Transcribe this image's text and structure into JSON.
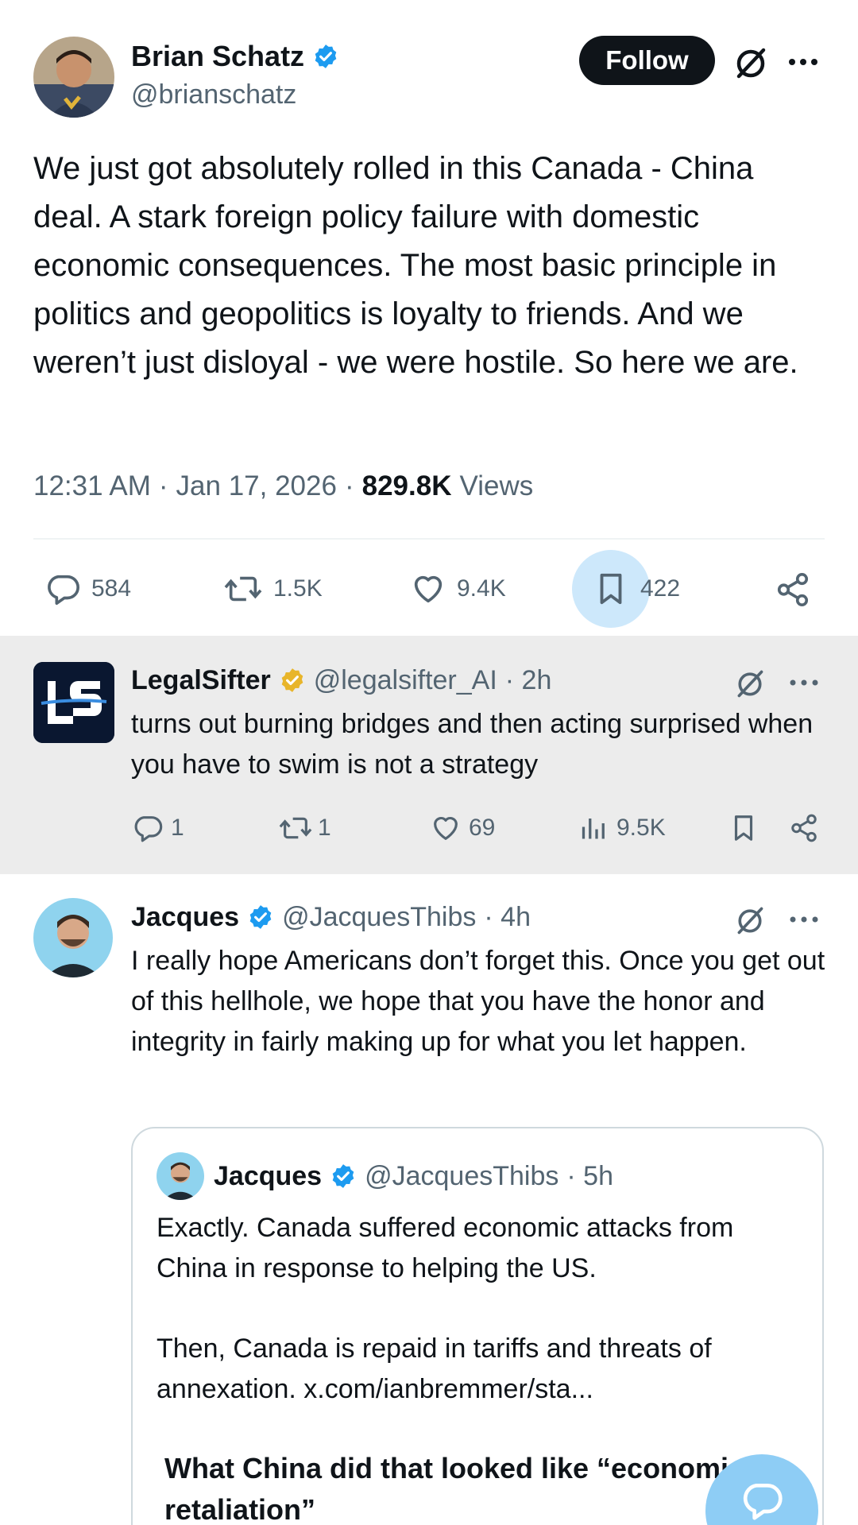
{
  "post": {
    "author_name": "Brian Schatz",
    "handle": "@brianschatz",
    "follow_label": "Follow",
    "text": "We just got absolutely rolled in this Canada - China deal. A stark foreign policy failure with domestic economic consequences. The most basic principle in politics and geopolitics is loyalty to friends. And we weren’t just disloyal - we were hostile. So here we are.",
    "time": "12:31 AM",
    "date": "Jan 17, 2026",
    "views_count": "829.8K",
    "views_label": "Views",
    "stats": {
      "replies": "584",
      "reposts": "1.5K",
      "likes": "9.4K",
      "bookmarks": "422"
    }
  },
  "replies": [
    {
      "author_name": "LegalSifter",
      "handle": "@legalsifter_AI",
      "time": "· 2h",
      "avatar_text": "LS",
      "text": "turns out burning bridges and then acting surprised when you have to swim is not a strategy",
      "stats": {
        "replies": "1",
        "reposts": "1",
        "likes": "69",
        "views": "9.5K"
      }
    },
    {
      "author_name": "Jacques",
      "handle": "@JacquesThibs",
      "time": "· 4h",
      "text": "I really hope Americans don’t forget this. Once you get out of this hellhole, we hope that you have the honor and integrity in fairly making up for what you let happen.",
      "quote": {
        "author_name": "Jacques",
        "handle": "@JacquesThibs",
        "time": "· 5h",
        "para1": "Exactly. Canada suffered economic attacks from China in response to helping the US.",
        "para2": "Then, Canada is repaid in tariffs and threats of annexation.  x.com/ianbremmer/sta...",
        "heading": "What China did that looked like “economic retaliation”"
      }
    }
  ],
  "colors": {
    "text": "#0f1419",
    "secondary": "#536471",
    "verified_blue": "#1d9bf0",
    "verified_gold": "#e8b52a",
    "highlight_bg": "#ececec",
    "bookmark_bubble": "#cde8fb",
    "fab": "#8ecdf5"
  }
}
